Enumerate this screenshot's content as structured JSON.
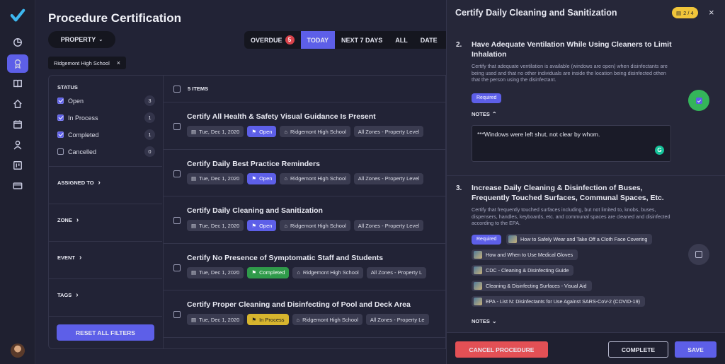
{
  "page": {
    "title": "Procedure Certification"
  },
  "toolbar": {
    "property_label": "PROPERTY",
    "tabs": [
      {
        "label": "OVERDUE",
        "badge": "5"
      },
      {
        "label": "TODAY"
      },
      {
        "label": "NEXT 7 DAYS"
      },
      {
        "label": "ALL"
      },
      {
        "label": "DATE"
      }
    ],
    "active_tab": "TODAY"
  },
  "filter_chip": {
    "label": "Ridgemont High School"
  },
  "filters": {
    "status_heading": "STATUS",
    "statuses": [
      {
        "label": "Open",
        "count": "3",
        "checked": true
      },
      {
        "label": "In Process",
        "count": "1",
        "checked": true
      },
      {
        "label": "Completed",
        "count": "1",
        "checked": true
      },
      {
        "label": "Cancelled",
        "count": "0",
        "checked": false
      }
    ],
    "sections": [
      "ASSIGNED TO",
      "ZONE",
      "EVENT",
      "TAGS"
    ],
    "reset_label": "RESET ALL FILTERS"
  },
  "list": {
    "count_label": "5 ITEMS",
    "items": [
      {
        "title": "Certify All Health & Safety Visual Guidance Is Present",
        "date": "Tue, Dec 1, 2020",
        "status": "Open",
        "location": "Ridgemont High School",
        "zone": "All Zones - Property Level"
      },
      {
        "title": "Certify Daily Best Practice Reminders",
        "date": "Tue, Dec 1, 2020",
        "status": "Open",
        "location": "Ridgemont High School",
        "zone": "All Zones - Property Level"
      },
      {
        "title": "Certify Daily Cleaning and Sanitization",
        "date": "Tue, Dec 1, 2020",
        "status": "Open",
        "location": "Ridgemont High School",
        "zone": "All Zones - Property Level"
      },
      {
        "title": "Certify No Presence of Symptomatic Staff and Students",
        "date": "Tue, Dec 1, 2020",
        "status": "Completed",
        "location": "Ridgemont High School",
        "zone": "All Zones - Property L"
      },
      {
        "title": "Certify Proper Cleaning and Disinfecting of Pool and Deck Area",
        "date": "Tue, Dec 1, 2020",
        "status": "In Process",
        "location": "Ridgemont High School",
        "zone": "All Zones - Property Le"
      }
    ]
  },
  "panel": {
    "title": "Certify Daily Cleaning and Sanitization",
    "progress_label": "2 / 4",
    "step2": {
      "num": "2.",
      "title": "Have Adequate Ventilation While Using Cleaners to Limit Inhalation",
      "desc": "Certify that adequate ventilation is available (windows are open) when disinfectants are being used and that no other individuals are inside the location being disinfected othen that the person using the disinfectant.",
      "required": "Required",
      "notes_label": "NOTES",
      "note_text": "***Windows were left shut, not clear by whom."
    },
    "step3": {
      "num": "3.",
      "title": "Increase Daily Cleaning & Disinfection of Buses, Frequently Touched Surfaces, Communal Spaces, Etc.",
      "desc": "Certify that frequently touched surfaces including, but not limited to, knobs, buses, dispensers, handles, keyboards, etc. and communal spaces are cleaned and disinfected according to the EPA.",
      "required": "Required",
      "resources": [
        "How to Safely Wear and Take Off a Cloth Face Covering",
        "How and When to Use Medical Gloves",
        "CDC - Cleaning & Disinfecting Guide",
        "Cleaning & Disinfecting Surfaces - Visual Aid",
        "EPA - List N: Disinfectants for Use Against SARS-CoV-2 (COVID-19)"
      ],
      "notes_label": "NOTES"
    },
    "footer": {
      "cancel": "CANCEL PROCEDURE",
      "complete": "COMPLETE",
      "save": "SAVE"
    }
  },
  "colors": {
    "accent": "#5d5fe8",
    "danger": "#e35055",
    "success": "#34b55a",
    "warning": "#d7b52e"
  }
}
